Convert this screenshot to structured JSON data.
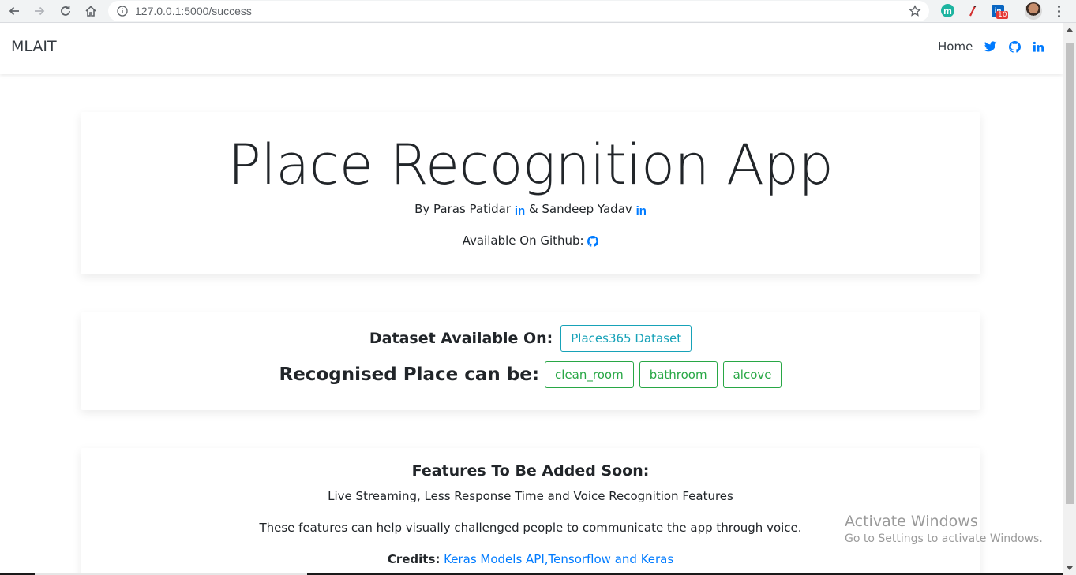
{
  "browser": {
    "url": "127.0.0.1:5000/success",
    "extensions": [
      "m",
      "lasso-icon",
      "linkedin-ext"
    ],
    "linkedin_badge": "10"
  },
  "nav": {
    "brand": "MLAIT",
    "home": "Home",
    "icons": [
      "twitter-icon",
      "github-icon",
      "linkedin-icon"
    ]
  },
  "hero": {
    "title": "Place Recognition App",
    "by_prefix": "By Paras Patidar",
    "by_joiner": "& Sandeep Yadav",
    "github_label": "Available On Github:"
  },
  "dataset": {
    "label": "Dataset Available On:",
    "button": "Places365 Dataset"
  },
  "recognition": {
    "label": "Recognised Place can be:",
    "places": [
      "clean_room",
      "bathroom",
      "alcove"
    ]
  },
  "features": {
    "title": "Features To Be Added Soon:",
    "line1": "Live Streaming, Less Response Time and Voice Recognition Features",
    "line2": "These features can help visually challenged people to communicate the app through voice.",
    "credits_label": "Credits:",
    "credits_link": "Keras Models API,Tensorflow and Keras"
  },
  "watermark": {
    "line1": "Activate Windows",
    "line2": "Go to Settings to activate Windows."
  },
  "colors": {
    "link": "#007bff",
    "info": "#17a2b8",
    "success": "#28a745"
  }
}
